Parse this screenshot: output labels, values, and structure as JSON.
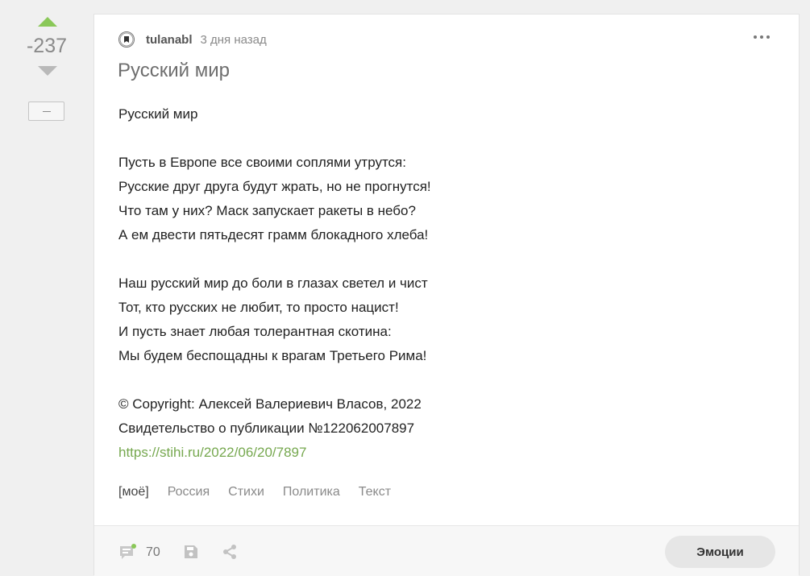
{
  "rating": {
    "score": "-237",
    "collapse_label": "−"
  },
  "post": {
    "author": "tulanabl",
    "time": "3 дня назад",
    "title": "Русский мир",
    "body_lines": [
      "Русский мир",
      "",
      "Пусть в Европе все своими соплями утрутся:",
      "Русские друг друга будут жрать, но не прогнутся!",
      "Что там у них? Маск запускает ракеты в небо?",
      "А ем двести пятьдесят грамм блокадного хлеба!",
      "",
      "Наш русский мир до боли в глазах светел и чист",
      "Тот, кто русских не любит, то просто нацист!",
      "И пусть знает любая толерантная скотина:",
      "Мы будем беспощадны к врагам Третьего Рима!",
      "",
      "© Copyright: Алексей Валериевич Власов, 2022",
      "Свидетельство о публикации №122062007897"
    ],
    "link": "https://stihi.ru/2022/06/20/7897",
    "tags": [
      "[моё]",
      "Россия",
      "Стихи",
      "Политика",
      "Текст"
    ]
  },
  "footer": {
    "comments_count": "70",
    "emotions_label": "Эмоции"
  },
  "colors": {
    "upvote": "#8ac858",
    "link": "#76a84f",
    "online_dot": "#8ac858"
  },
  "icons": [
    "vote-up-icon",
    "vote-down-icon",
    "avatar-icon",
    "more-icon",
    "comments-icon",
    "save-icon",
    "share-icon"
  ]
}
